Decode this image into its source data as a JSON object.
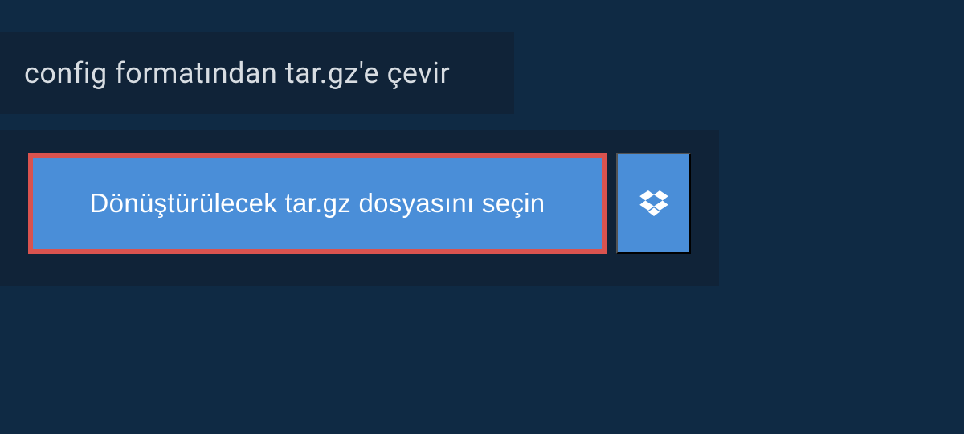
{
  "header": {
    "title": "config formatından tar.gz'e çevir"
  },
  "content": {
    "select_file_label": "Dönüştürülecek tar.gz dosyasını seçin"
  },
  "colors": {
    "background": "#0f2a44",
    "panel": "#102338",
    "button_primary": "#4a8ed8",
    "button_border": "#d9534f",
    "text_light": "#d8dde2",
    "text_white": "#ffffff"
  }
}
